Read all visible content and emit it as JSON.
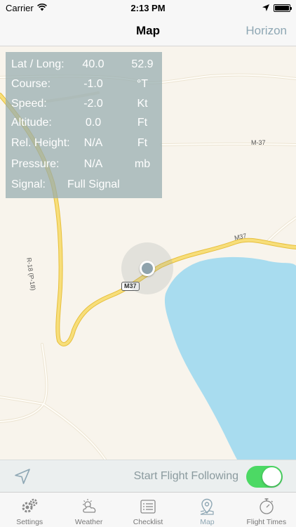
{
  "status_bar": {
    "carrier": "Carrier",
    "time": "2:13 PM"
  },
  "nav": {
    "title": "Map",
    "right_button": "Horizon"
  },
  "map": {
    "road_labels": {
      "m37_right": "M-37",
      "r18": "R-18 (P-18)",
      "m37_upper": "M37",
      "m37_shield": "M37"
    }
  },
  "info_panel": {
    "lat_long": {
      "label": "Lat / Long:",
      "value": "40.0",
      "unit": "52.9"
    },
    "course": {
      "label": "Course:",
      "value": "-1.0",
      "unit": "°T"
    },
    "speed": {
      "label": "Speed:",
      "value": "-2.0",
      "unit": "Kt"
    },
    "altitude": {
      "label": "Altitude:",
      "value": "0.0",
      "unit": "Ft"
    },
    "rel_height": {
      "label": "Rel. Height:",
      "value": "N/A",
      "unit": "Ft"
    },
    "pressure": {
      "label": "Pressure:",
      "value": "N/A",
      "unit": "mb"
    },
    "signal": {
      "label": "Signal:",
      "value": "Full Signal"
    }
  },
  "follow_bar": {
    "label": "Start Flight Following",
    "toggle_on": true
  },
  "tabs": [
    {
      "label": "Settings",
      "icon": "gears-icon",
      "active": false
    },
    {
      "label": "Weather",
      "icon": "weather-icon",
      "active": false
    },
    {
      "label": "Checklist",
      "icon": "checklist-icon",
      "active": false
    },
    {
      "label": "Map",
      "icon": "map-pin-icon",
      "active": true
    },
    {
      "label": "Flight Times",
      "icon": "stopwatch-icon",
      "active": false
    }
  ],
  "colors": {
    "accent": "#8ea7b4",
    "toggle_on": "#4cd964",
    "water": "#a8dcef",
    "land": "#f8f4ec",
    "highway": "#f5d35a"
  }
}
